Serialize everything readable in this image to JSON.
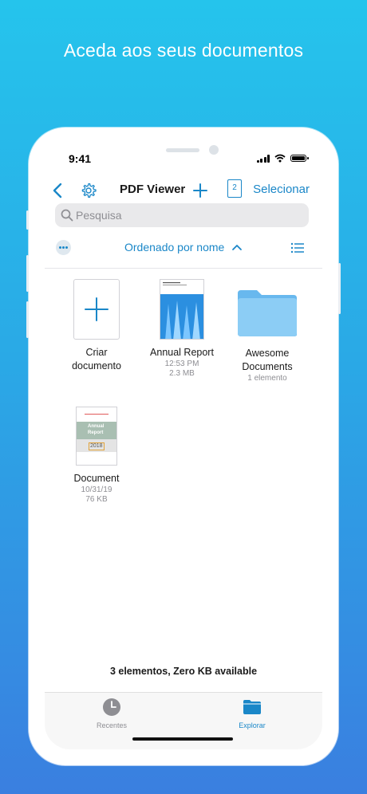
{
  "headline": "Aceda aos seus documentos",
  "status_bar": {
    "time": "9:41"
  },
  "navbar": {
    "title": "PDF Viewer",
    "page_badge": "2",
    "select_label": "Selecionar"
  },
  "search": {
    "placeholder": "Pesquisa"
  },
  "sort": {
    "label": "Ordenado por nome"
  },
  "items": [
    {
      "name_line1": "Criar",
      "name_line2": "documento",
      "meta1": "",
      "meta2": ""
    },
    {
      "name_line1": "Annual Report",
      "name_line2": "",
      "meta1": "12:53 PM",
      "meta2": "2.3 MB"
    },
    {
      "name_line1": "Awesome",
      "name_line2": "Documents",
      "meta1": "1 elemento",
      "meta2": ""
    },
    {
      "name_line1": "Document",
      "name_line2": "",
      "meta1": "10/31/19",
      "meta2": "76 KB"
    }
  ],
  "thumb_doc": {
    "line1": "Annual",
    "line2": "Report",
    "year": "2018"
  },
  "footer": {
    "count_text": "3 elementos, Zero KB available"
  },
  "tabbar": {
    "tabs": [
      {
        "label": "Recentes",
        "icon": "clock-icon",
        "active": false
      },
      {
        "label": "Explorar",
        "icon": "folder-icon",
        "active": true
      }
    ]
  },
  "colors": {
    "accent": "#1a87c8",
    "inactive": "#8e8e93"
  }
}
